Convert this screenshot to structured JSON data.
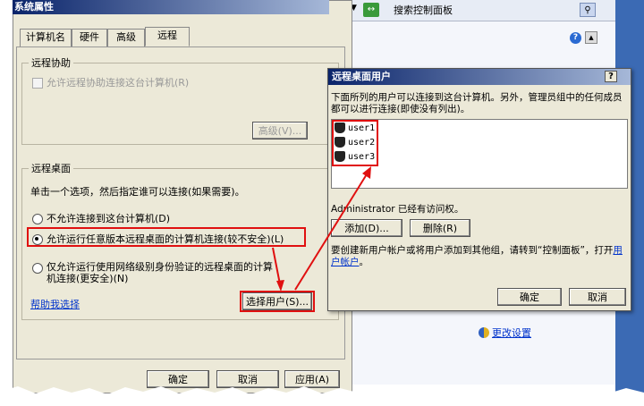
{
  "system_props": {
    "title": "系统属性",
    "tabs": [
      "计算机名",
      "硬件",
      "高级",
      "远程"
    ],
    "remote_assist": {
      "legend": "远程协助",
      "checkbox_label": "允许远程协助连接这台计算机(R)",
      "advanced_button": "高级(V)..."
    },
    "remote_desktop": {
      "legend": "远程桌面",
      "instruction": "单击一个选项，然后指定谁可以连接(如果需要)。",
      "options": [
        "不允许连接到这台计算机(D)",
        "允许运行任意版本远程桌面的计算机连接(较不安全)(L)",
        "仅允许运行使用网络级别身份验证的远程桌面的计算机连接(更安全)(N)"
      ],
      "help_link": "帮助我选择",
      "select_users_button": "选择用户(S)..."
    },
    "footer_buttons": [
      "确定",
      "取消",
      "应用(A)"
    ]
  },
  "control_panel": {
    "search_placeholder": "搜索控制面板",
    "change_settings_link": "更改设置"
  },
  "rdu_dialog": {
    "title": "远程桌面用户",
    "help_char": "?",
    "description": "下面所列的用户可以连接到这台计算机。另外，管理员组中的任何成员都可以进行连接(即使没有列出)。",
    "users": [
      "user1",
      "user2",
      "user3"
    ],
    "access_note": "Administrator 已经有访问权。",
    "add_button": "添加(D)...",
    "remove_button": "删除(R)",
    "create_note": "要创建新用户帐户或将用户添加到其他组，请转到“控制面板”，打开",
    "user_accounts_link": "用户帐户",
    "period": "。",
    "ok_button": "确定",
    "cancel_button": "取消"
  },
  "colors": {
    "highlight": "#e01010",
    "title_bar": "#0a246a",
    "dialog_bg": "#ece9d8"
  }
}
